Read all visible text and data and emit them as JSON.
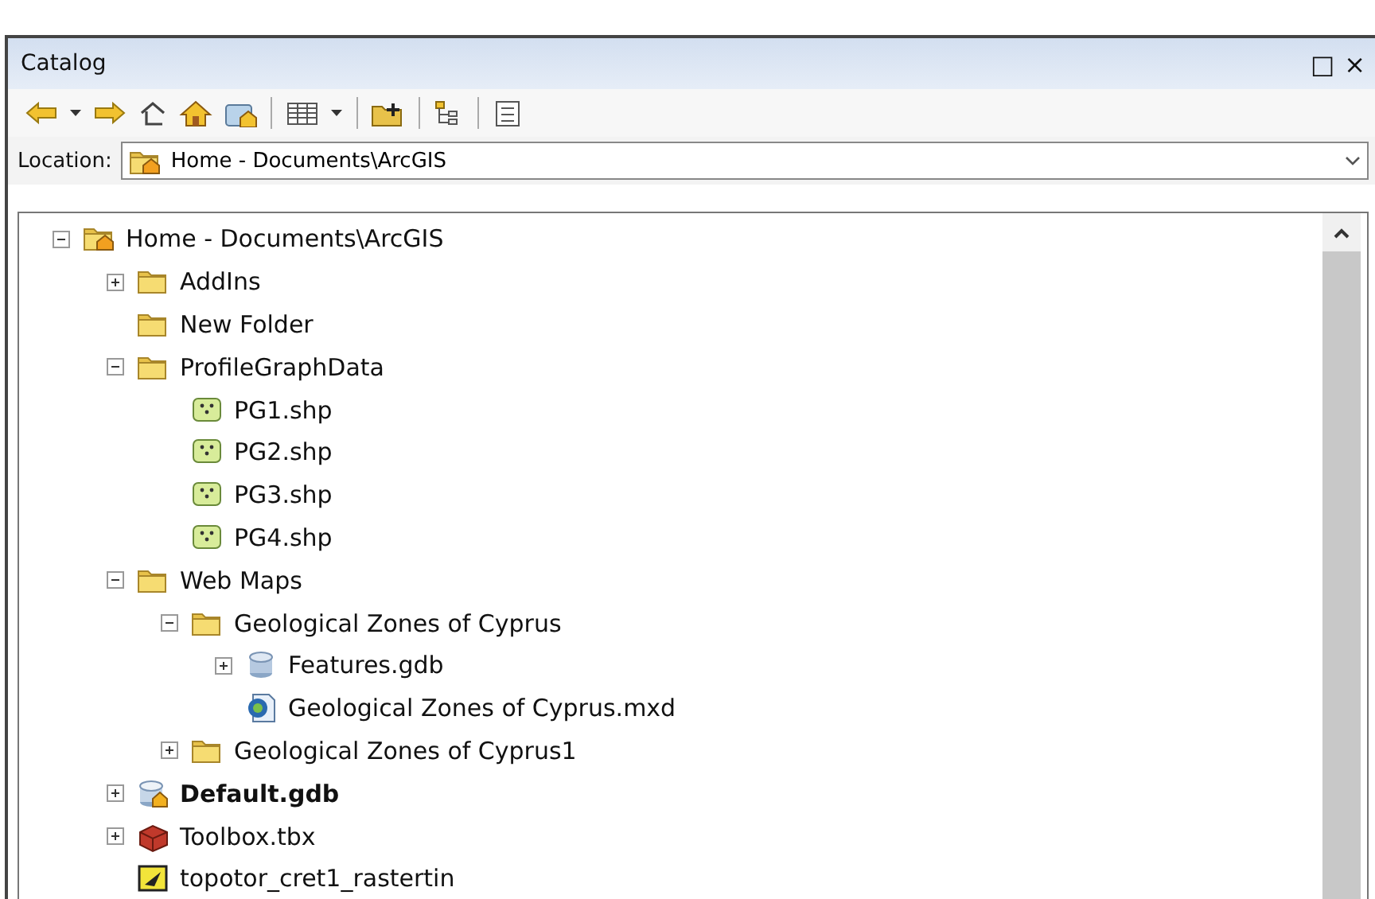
{
  "window": {
    "title": "Catalog",
    "controls": [
      "□",
      "×"
    ]
  },
  "toolbar": {
    "buttons": [
      {
        "kind": "back"
      },
      {
        "kind": "caret"
      },
      {
        "kind": "forward"
      },
      {
        "kind": "up"
      },
      {
        "kind": "home"
      },
      {
        "kind": "connect"
      },
      {
        "kind": "sep"
      },
      {
        "kind": "grid"
      },
      {
        "kind": "caret"
      },
      {
        "kind": "sep"
      },
      {
        "kind": "newfolder"
      },
      {
        "kind": "sep"
      },
      {
        "kind": "tree"
      },
      {
        "kind": "sep"
      },
      {
        "kind": "details"
      }
    ]
  },
  "location": {
    "label": "Location:",
    "value": "Home - Documents\\ArcGIS"
  },
  "tree": [
    {
      "label": "Home - Documents\\ArcGIS",
      "kind": "homefolder",
      "expanded": true,
      "bold": false,
      "children": [
        {
          "label": "AddIns",
          "kind": "folder",
          "expanded": false,
          "bold": false
        },
        {
          "label": "New Folder",
          "kind": "folder",
          "bold": false
        },
        {
          "label": "ProfileGraphData",
          "kind": "folder",
          "expanded": true,
          "bold": false,
          "children": [
            {
              "label": "PG1.shp",
              "kind": "shapefile",
              "bold": false
            },
            {
              "label": "PG2.shp",
              "kind": "shapefile",
              "bold": false
            },
            {
              "label": "PG3.shp",
              "kind": "shapefile",
              "bold": false
            },
            {
              "label": "PG4.shp",
              "kind": "shapefile",
              "bold": false
            }
          ]
        },
        {
          "label": "Web Maps",
          "kind": "folder",
          "expanded": true,
          "bold": false,
          "children": [
            {
              "label": "Geological Zones of Cyprus",
              "kind": "folder",
              "expanded": true,
              "bold": false,
              "children": [
                {
                  "label": "Features.gdb",
                  "kind": "database",
                  "expanded": false,
                  "bold": false
                },
                {
                  "label": "Geological Zones of Cyprus.mxd",
                  "kind": "mapdoc",
                  "bold": false
                }
              ]
            },
            {
              "label": "Geological Zones of Cyprus1",
              "kind": "folder",
              "expanded": false,
              "bold": false
            }
          ]
        },
        {
          "label": "Default.gdb",
          "kind": "homedatabase",
          "expanded": false,
          "bold": true
        },
        {
          "label": "Toolbox.tbx",
          "kind": "toolbox",
          "expanded": false,
          "bold": false
        },
        {
          "label": "topotor_cret1_rastertin",
          "kind": "tin",
          "bold": false
        }
      ]
    }
  ]
}
